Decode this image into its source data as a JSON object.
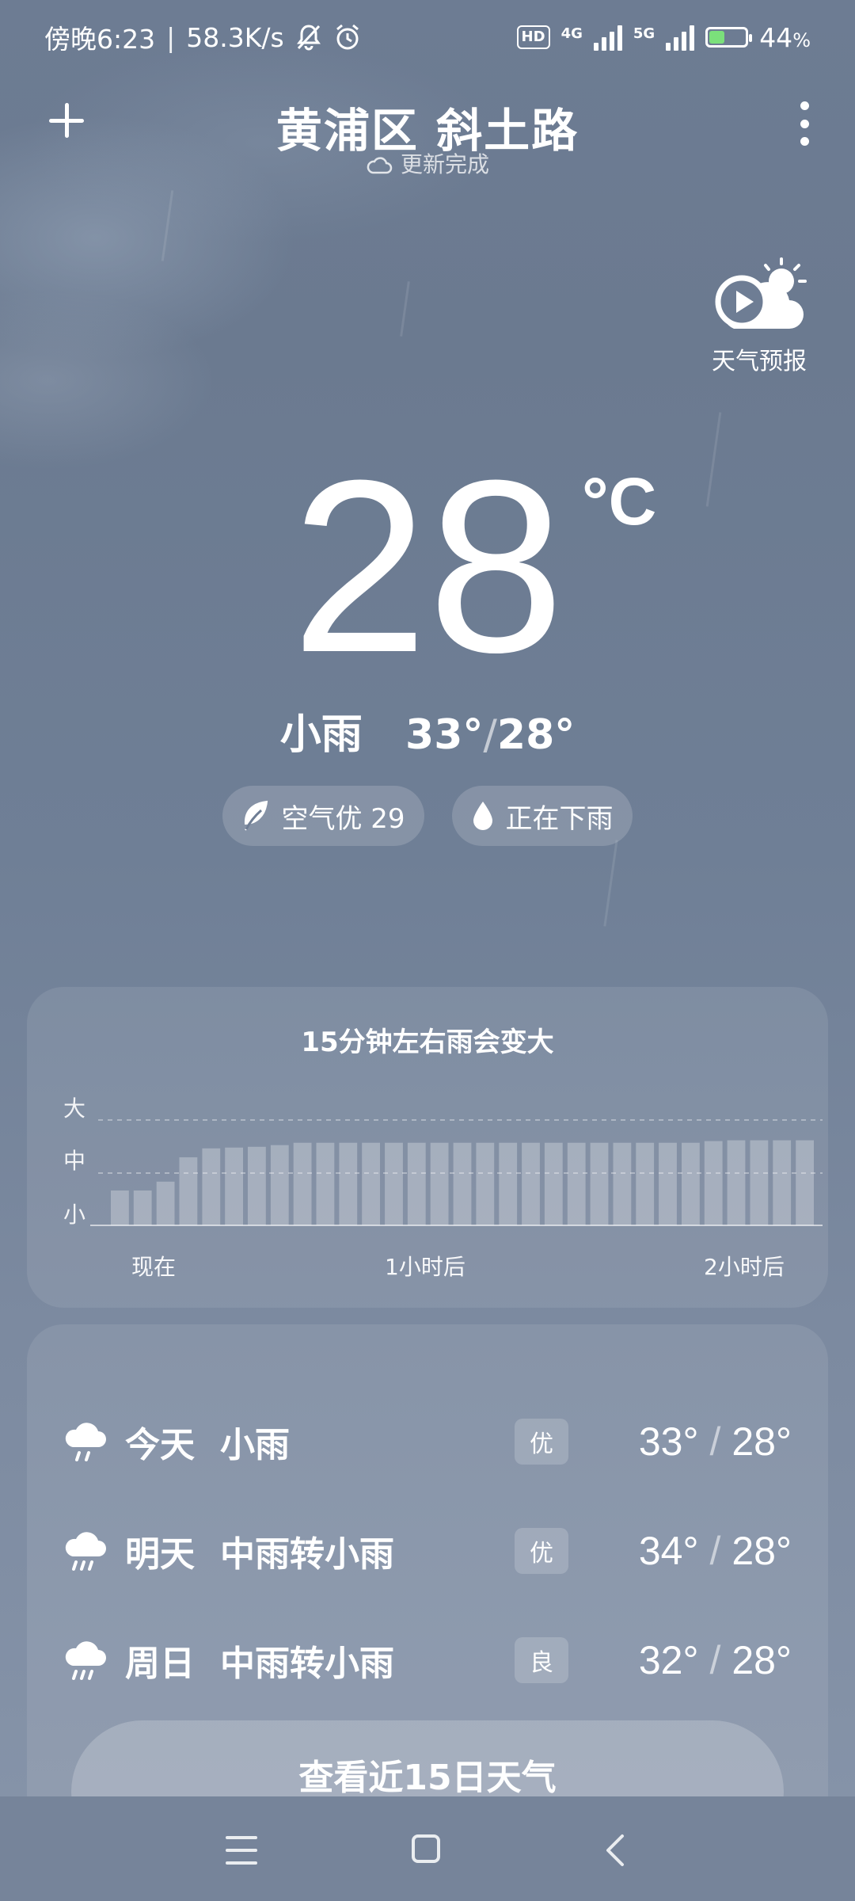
{
  "status_bar": {
    "time": "傍晚6:23",
    "net_speed": "58.3K/s",
    "icons": [
      "bell-muted-icon",
      "alarm-icon",
      "hd-icon",
      "signal-4g-icon",
      "signal-5g-icon",
      "battery-icon"
    ],
    "hd_label": "HD",
    "net1": "4G",
    "net2": "5G",
    "battery": "44",
    "battery_unit": "%",
    "battery_level": 0.44
  },
  "header": {
    "location": "黄浦区 斜土路",
    "update_status": "更新完成",
    "add_icon": "plus-icon",
    "menu_icon": "more-vertical-icon"
  },
  "forecast_video": {
    "label": "天气预报",
    "icon": "weather-video-icon"
  },
  "current": {
    "temperature": "28",
    "unit": "°C",
    "condition": "小雨",
    "high": "33°",
    "separator": "/",
    "low": "28°",
    "air_quality": "空气优 29",
    "rain_status": "正在下雨"
  },
  "precipitation": {
    "title": "15分钟左右雨会变大",
    "y_levels": [
      "大",
      "中",
      "小"
    ],
    "x_labels": [
      "现在",
      "1小时后",
      "2小时后"
    ]
  },
  "chart_data": {
    "type": "bar",
    "title": "15分钟左右雨会变大",
    "y_categories": [
      "小",
      "中",
      "大"
    ],
    "xlabels": [
      "现在",
      "1小时后",
      "2小时后"
    ],
    "values": [
      0.43,
      0.43,
      0.54,
      0.84,
      0.95,
      0.96,
      0.97,
      0.99,
      1.02,
      1.02,
      1.02,
      1.02,
      1.02,
      1.02,
      1.02,
      1.02,
      1.02,
      1.02,
      1.02,
      1.02,
      1.02,
      1.02,
      1.02,
      1.02,
      1.02,
      1.02,
      1.04,
      1.05,
      1.05,
      1.05,
      1.05
    ],
    "ylim": [
      0,
      1.5
    ],
    "unit_note": "intensity levels: 小 ≈ 0.5, 中 ≈ 1.0"
  },
  "daily": [
    {
      "day": "今天",
      "condition": "小雨",
      "aqi": "优",
      "high": "33°",
      "low": "28°",
      "icon": "light-rain-icon"
    },
    {
      "day": "明天",
      "condition": "中雨转小雨",
      "aqi": "优",
      "high": "34°",
      "low": "28°",
      "icon": "moderate-rain-icon"
    },
    {
      "day": "周日",
      "condition": "中雨转小雨",
      "aqi": "良",
      "high": "32°",
      "low": "28°",
      "icon": "moderate-rain-icon"
    }
  ],
  "more_button": "查看近15日天气",
  "nav": {
    "menu": "menu-icon",
    "home": "home-icon",
    "back": "back-icon"
  }
}
